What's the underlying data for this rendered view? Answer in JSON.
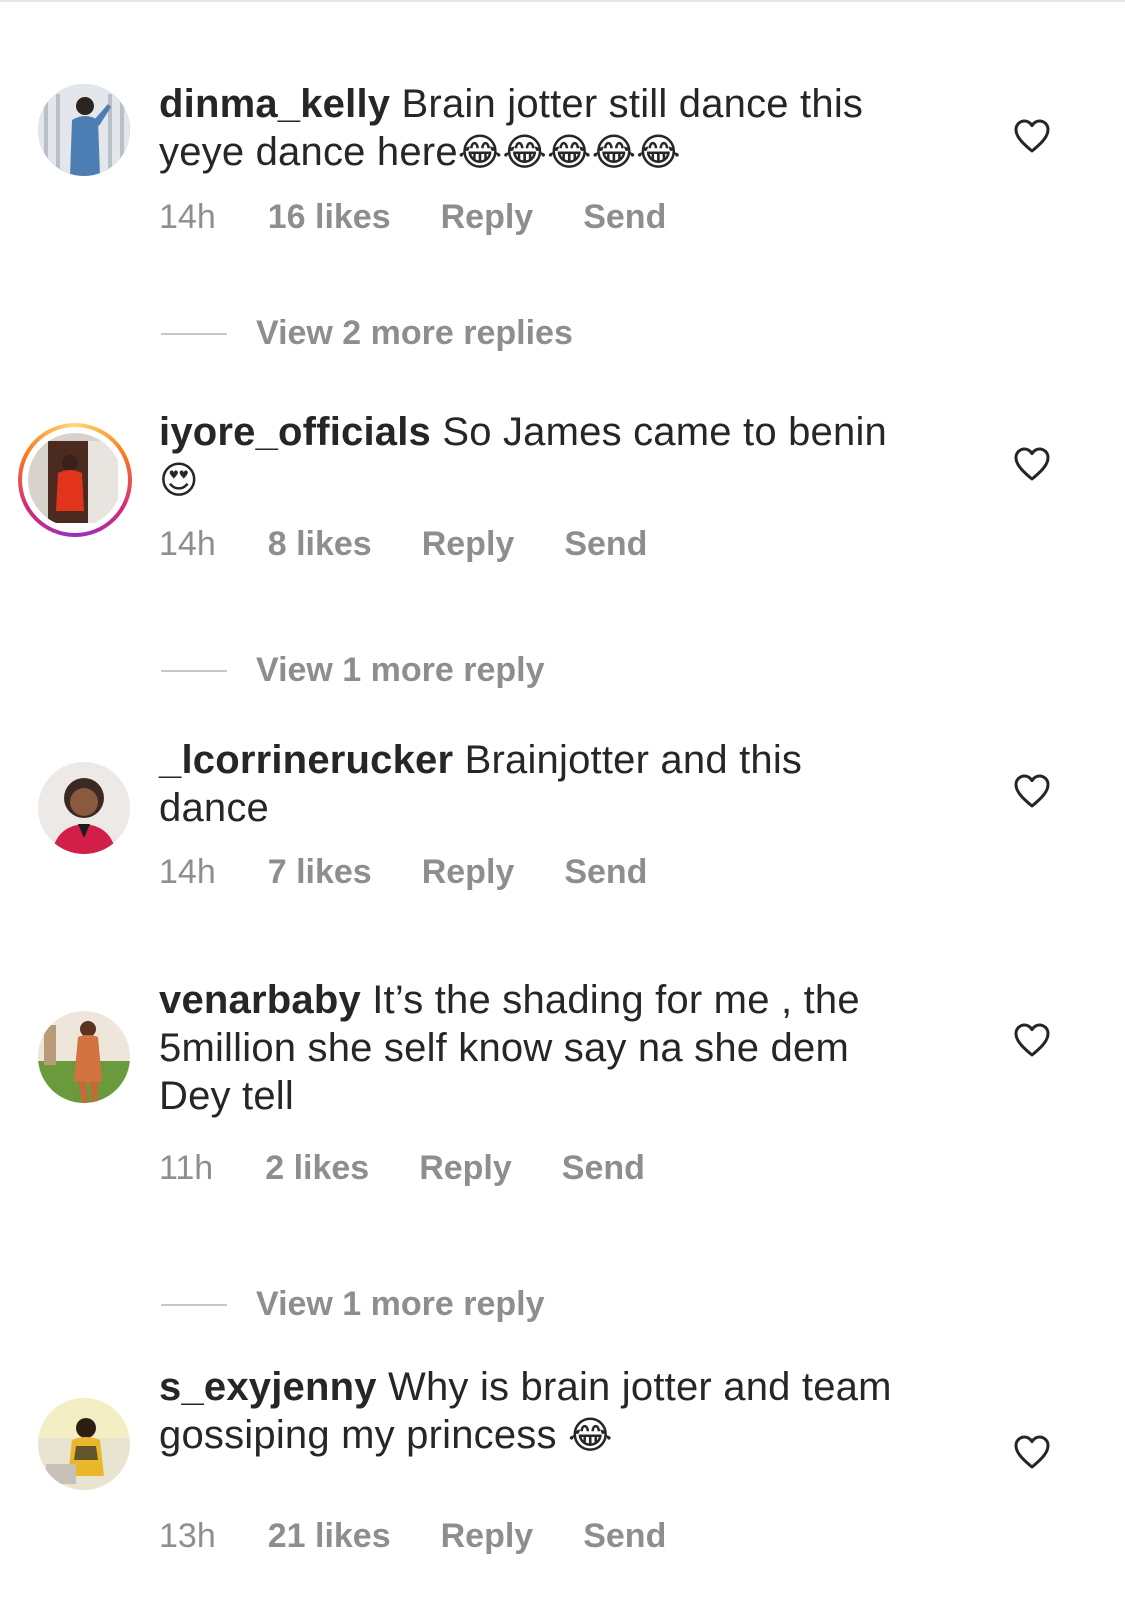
{
  "comments": [
    {
      "username": "dinma_kelly",
      "text_line1": "Brain jotter still dance this",
      "text_line2": "yeye dance here",
      "emoji": "😂😂😂😂😂",
      "time": "14h",
      "likes": "16 likes",
      "reply": "Reply",
      "send": "Send",
      "view_more": "View 2 more replies"
    },
    {
      "username": "iyore_officials",
      "text_line1": "So James came to benin",
      "emoji": "😍",
      "time": "14h",
      "likes": "8 likes",
      "reply": "Reply",
      "send": "Send",
      "view_more": "View 1 more reply"
    },
    {
      "username": "_lcorrinerucker",
      "text_line1": "Brainjotter and this",
      "text_line2": "dance",
      "time": "14h",
      "likes": "7 likes",
      "reply": "Reply",
      "send": "Send"
    },
    {
      "username": "venarbaby",
      "text_line1": "It’s the shading for me , the",
      "text_line2": "5million she self know say na she dem",
      "text_line3": "Dey tell",
      "time": "11h",
      "likes": "2 likes",
      "reply": "Reply",
      "send": "Send",
      "view_more": "View 1 more reply"
    },
    {
      "username": "s_exyjenny",
      "text_line1": "Why is brain jotter and team",
      "text_line2": "gossiping my princess",
      "emoji": "😂",
      "time": "13h",
      "likes": "21 likes",
      "reply": "Reply",
      "send": "Send"
    }
  ],
  "icons": {
    "like": "heart-outline-icon"
  },
  "colors": {
    "text": "#262626",
    "secondary": "#8e8e8e",
    "story_ring": [
      "#feda75",
      "#fa7e1e",
      "#d62976",
      "#962fbf"
    ]
  }
}
